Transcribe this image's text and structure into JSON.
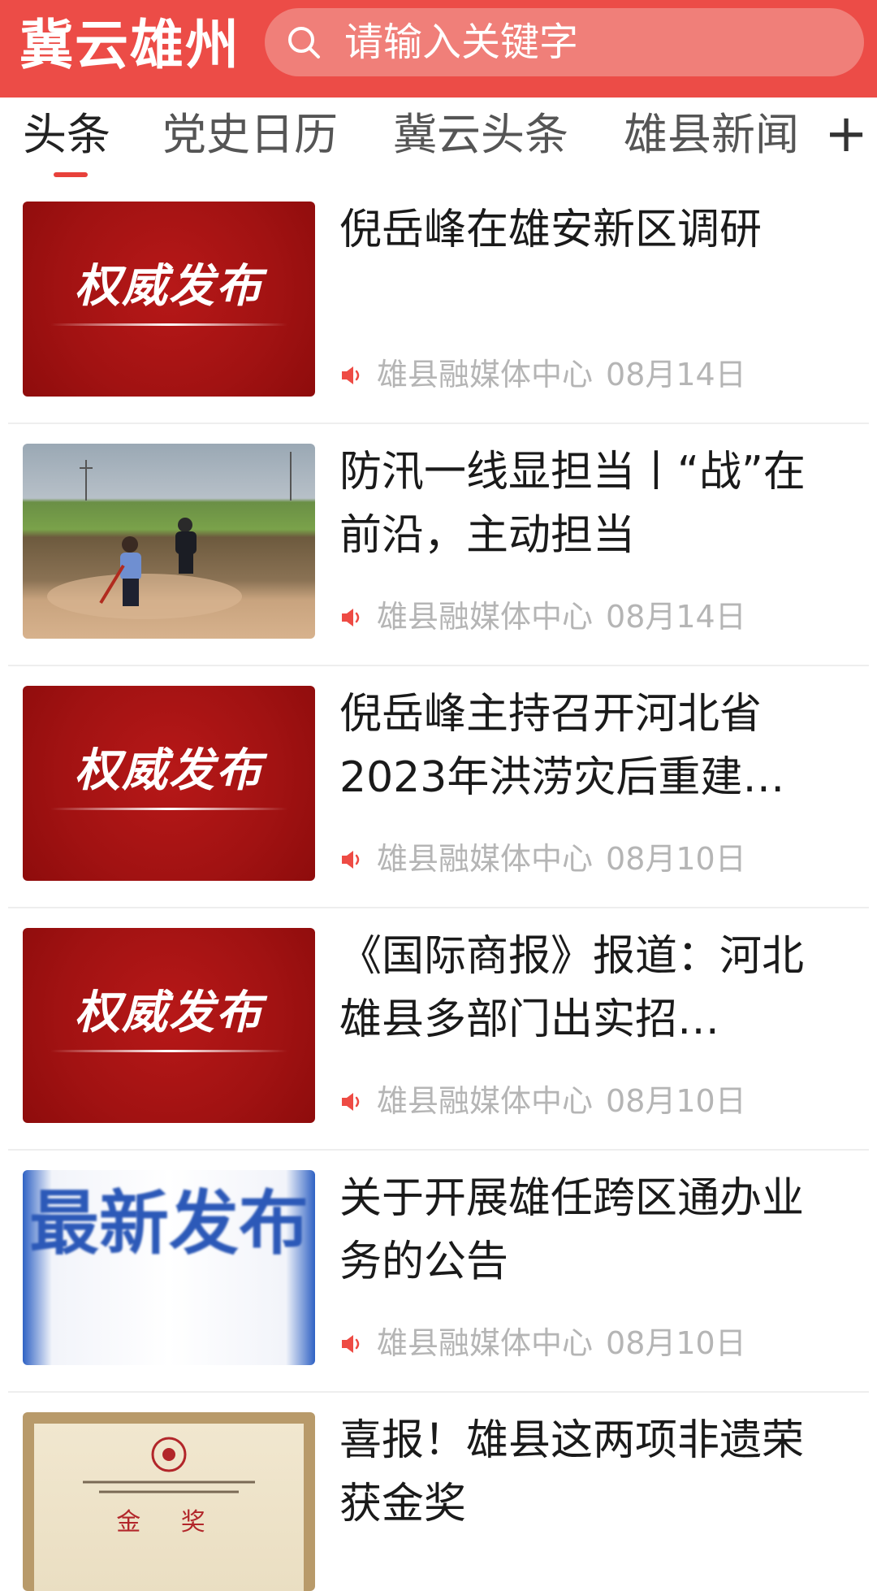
{
  "header": {
    "brand": "冀云雄州",
    "search_placeholder": "请输入关键字",
    "brand_color": "#ec4c47"
  },
  "tabs": [
    {
      "label": "头条",
      "active": true
    },
    {
      "label": "党史日历",
      "active": false
    },
    {
      "label": "冀云头条",
      "active": false
    },
    {
      "label": "雄县新闻",
      "active": false
    }
  ],
  "tab_add_label": "+",
  "news": [
    {
      "title": "倪岳峰在雄安新区调研",
      "source": "雄县融媒体中心",
      "date": "08月14日",
      "thumb": "权威发布"
    },
    {
      "title": "防汛一线显担当丨“战”在前沿，主动担当",
      "source": "雄县融媒体中心",
      "date": "08月14日",
      "thumb": ""
    },
    {
      "title": "倪岳峰主持召开河北省2023年洪涝灾后重建…",
      "source": "雄县融媒体中心",
      "date": "08月10日",
      "thumb": "权威发布"
    },
    {
      "title": "《国际商报》报道：河北雄县多部门出实招…",
      "source": "雄县融媒体中心",
      "date": "08月10日",
      "thumb": "权威发布"
    },
    {
      "title": "关于开展雄任跨区通办业务的公告",
      "source": "雄县融媒体中心",
      "date": "08月10日",
      "thumb": "最新发布"
    },
    {
      "title": "喜报！雄县这两项非遗荣获金奖",
      "source": "",
      "date": "",
      "thumb": "金 奖"
    }
  ]
}
